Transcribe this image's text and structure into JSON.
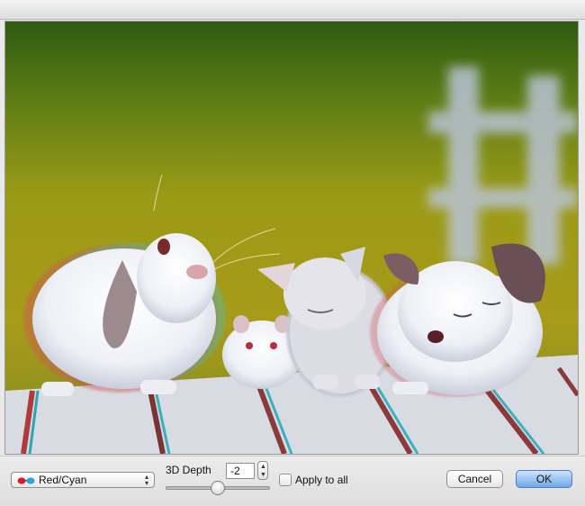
{
  "dialog": {
    "mode_select": {
      "value": "Red/Cyan",
      "icon": "red-cyan-glasses-icon"
    },
    "depth": {
      "label": "3D Depth",
      "value": "-2",
      "slider_fraction": 0.5
    },
    "apply_all": {
      "label": "Apply to all",
      "checked": false
    },
    "buttons": {
      "cancel": "Cancel",
      "ok": "OK"
    }
  }
}
